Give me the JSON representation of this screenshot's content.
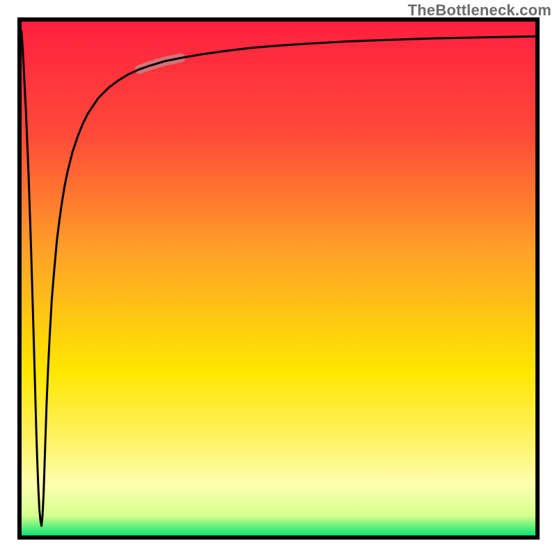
{
  "watermark": "TheBottleneck.com",
  "chart_data": {
    "type": "line",
    "title": "",
    "xlabel": "",
    "ylabel": "",
    "xlim": [
      0,
      100
    ],
    "ylim": [
      0,
      100
    ],
    "grid": false,
    "legend": null,
    "background_gradient_stops": [
      {
        "pct": 0,
        "color": "#ff1f3f"
      },
      {
        "pct": 22,
        "color": "#ff4a39"
      },
      {
        "pct": 45,
        "color": "#ffa227"
      },
      {
        "pct": 68,
        "color": "#ffe600"
      },
      {
        "pct": 82,
        "color": "#fff36a"
      },
      {
        "pct": 90,
        "color": "#fdffb0"
      },
      {
        "pct": 96,
        "color": "#d7ff8f"
      },
      {
        "pct": 100,
        "color": "#00e371"
      }
    ],
    "x": [
      0.1,
      0.3,
      0.6,
      1.0,
      1.5,
      2.0,
      2.5,
      3.0,
      3.2,
      3.4,
      3.6,
      3.8,
      4.0,
      4.2,
      4.4,
      4.6,
      4.8,
      5.0,
      5.3,
      5.6,
      6.0,
      6.5,
      7.0,
      7.5,
      8.0,
      8.5,
      9.0,
      9.5,
      10.0,
      11.0,
      12.0,
      13.0,
      14.0,
      15.0,
      17.0,
      19.0,
      21.0,
      23.0,
      25.0,
      28.0,
      31.0,
      35.0,
      40.0,
      45.0,
      50.0,
      56.0,
      63.0,
      71.0,
      80.0,
      90.0,
      100.0
    ],
    "values": [
      98.0,
      95.5,
      90.0,
      82.0,
      70.0,
      55.0,
      38.0,
      20.0,
      14.0,
      9.0,
      5.0,
      3.0,
      2.0,
      4.0,
      8.0,
      14.0,
      20.0,
      26.0,
      33.0,
      39.0,
      46.0,
      52.0,
      57.5,
      61.5,
      65.0,
      68.0,
      70.5,
      72.5,
      74.5,
      77.5,
      80.0,
      82.0,
      83.5,
      85.0,
      87.0,
      88.5,
      89.7,
      90.6,
      91.3,
      92.2,
      92.8,
      93.5,
      94.2,
      94.8,
      95.2,
      95.6,
      96.0,
      96.3,
      96.6,
      96.8,
      97.0
    ],
    "note_segment": {
      "x_start": 23.0,
      "x_end": 31.0
    }
  }
}
